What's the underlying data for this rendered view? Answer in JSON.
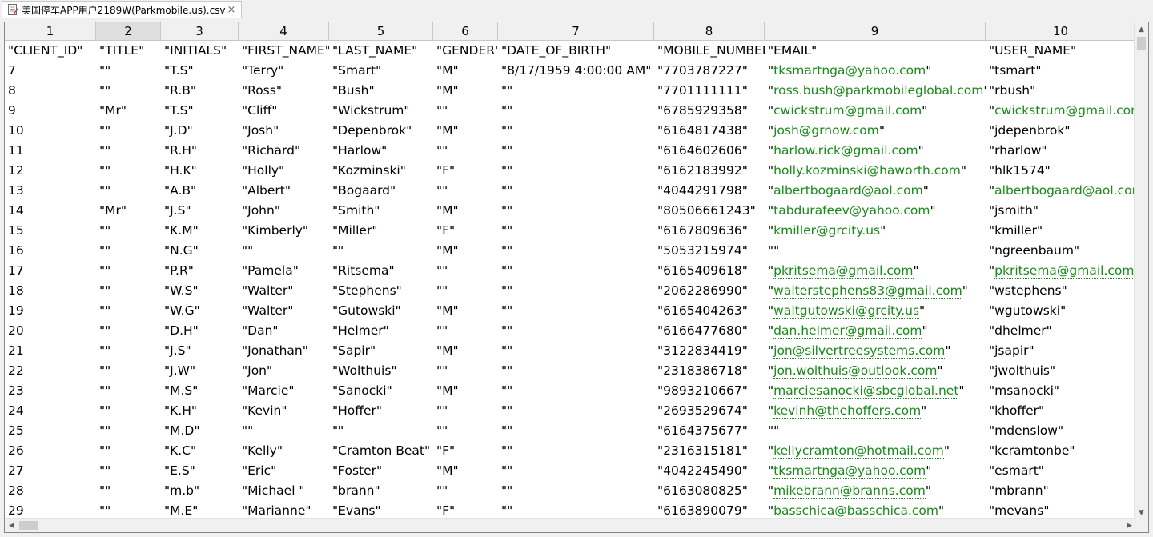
{
  "tab": {
    "title": "美国停车APP用户2189W(Parkmobile.us).csv",
    "close_glyph": "×",
    "icon": "csv-file-icon"
  },
  "column_numbers": [
    "1",
    "2",
    "3",
    "4",
    "5",
    "6",
    "7",
    "8",
    "9",
    "10"
  ],
  "selected_column": "2",
  "rows": [
    [
      "\"CLIENT_ID\"",
      "\"TITLE\"",
      "\"INITIALS\"",
      "\"FIRST_NAME\"",
      "\"LAST_NAME\"",
      "\"GENDER\"",
      "\"DATE_OF_BIRTH\"",
      "\"MOBILE_NUMBER\"",
      "\"EMAIL\"",
      "\"USER_NAME\""
    ],
    [
      "7",
      "\"\"",
      "\"T.S\"",
      "\"Terry\"",
      "\"Smart\"",
      "\"M\"",
      "\"8/17/1959 4:00:00 AM\"",
      "\"7703787227\"",
      "\"tksmartnga@yahoo.com\"",
      "\"tsmart\""
    ],
    [
      "8",
      "\"\"",
      "\"R.B\"",
      "\"Ross\"",
      "\"Bush\"",
      "\"M\"",
      "\"\"",
      "\"7701111111\"",
      "\"ross.bush@parkmobileglobal.com\"",
      "\"rbush\""
    ],
    [
      "9",
      "\"Mr\"",
      "\"T.S\"",
      "\"Cliff\"",
      "\"Wickstrum\"",
      "\"\"",
      "\"\"",
      "\"6785929358\"",
      "\"cwickstrum@gmail.com\"",
      "\"cwickstrum@gmail.com\""
    ],
    [
      "10",
      "\"\"",
      "\"J.D\"",
      "\"Josh\"",
      "\"Depenbrok\"",
      "\"M\"",
      "\"\"",
      "\"6164817438\"",
      "\"josh@grnow.com\"",
      "\"jdepenbrok\""
    ],
    [
      "11",
      "\"\"",
      "\"R.H\"",
      "\"Richard\"",
      "\"Harlow\"",
      "\"\"",
      "\"\"",
      "\"6164602606\"",
      "\"harlow.rick@gmail.com\"",
      "\"rharlow\""
    ],
    [
      "12",
      "\"\"",
      "\"H.K\"",
      "\"Holly\"",
      "\"Kozminski\"",
      "\"F\"",
      "\"\"",
      "\"6162183992\"",
      "\"holly.kozminski@haworth.com\"",
      "\"hlk1574\""
    ],
    [
      "13",
      "\"\"",
      "\"A.B\"",
      "\"Albert\"",
      "\"Bogaard\"",
      "\"\"",
      "\"\"",
      "\"4044291798\"",
      "\"albertbogaard@aol.com\"",
      "\"albertbogaard@aol.com\""
    ],
    [
      "14",
      "\"Mr\"",
      "\"J.S\"",
      "\"John\"",
      "\"Smith\"",
      "\"M\"",
      "\"\"",
      "\"80506661243\"",
      "\"tabdurafeev@yahoo.com\"",
      "\"jsmith\""
    ],
    [
      "15",
      "\"\"",
      "\"K.M\"",
      "\"Kimberly\"",
      "\"Miller\"",
      "\"F\"",
      "\"\"",
      "\"6167809636\"",
      "\"kmiller@grcity.us\"",
      "\"kmiller\""
    ],
    [
      "16",
      "\"\"",
      "\"N.G\"",
      "\"\"",
      "\"\"",
      "\"M\"",
      "\"\"",
      "\"5053215974\"",
      "\"\"",
      "\"ngreenbaum\""
    ],
    [
      "17",
      "\"\"",
      "\"P.R\"",
      "\"Pamela\"",
      "\"Ritsema\"",
      "\"\"",
      "\"\"",
      "\"6165409618\"",
      "\"pkritsema@gmail.com\"",
      "\"pkritsema@gmail.com\""
    ],
    [
      "18",
      "\"\"",
      "\"W.S\"",
      "\"Walter\"",
      "\"Stephens\"",
      "\"\"",
      "\"\"",
      "\"2062286990\"",
      "\"walterstephens83@gmail.com\"",
      "\"wstephens\""
    ],
    [
      "19",
      "\"\"",
      "\"W.G\"",
      "\"Walter\"",
      "\"Gutowski\"",
      "\"M\"",
      "\"\"",
      "\"6165404263\"",
      "\"waltgutowski@grcity.us\"",
      "\"wgutowski\""
    ],
    [
      "20",
      "\"\"",
      "\"D.H\"",
      "\"Dan\"",
      "\"Helmer\"",
      "\"\"",
      "\"\"",
      "\"6166477680\"",
      "\"dan.helmer@gmail.com\"",
      "\"dhelmer\""
    ],
    [
      "21",
      "\"\"",
      "\"J.S\"",
      "\"Jonathan\"",
      "\"Sapir\"",
      "\"M\"",
      "\"\"",
      "\"3122834419\"",
      "\"jon@silvertreesystems.com\"",
      "\"jsapir\""
    ],
    [
      "22",
      "\"\"",
      "\"J.W\"",
      "\"Jon\"",
      "\"Wolthuis\"",
      "\"\"",
      "\"\"",
      "\"2318386718\"",
      "\"jon.wolthuis@outlook.com\"",
      "\"jwolthuis\""
    ],
    [
      "23",
      "\"\"",
      "\"M.S\"",
      "\"Marcie\"",
      "\"Sanocki\"",
      "\"M\"",
      "\"\"",
      "\"9893210667\"",
      "\"marciesanocki@sbcglobal.net\"",
      "\"msanocki\""
    ],
    [
      "24",
      "\"\"",
      "\"K.H\"",
      "\"Kevin\"",
      "\"Hoffer\"",
      "\"\"",
      "\"\"",
      "\"2693529674\"",
      "\"kevinh@thehoffers.com\"",
      "\"khoffer\""
    ],
    [
      "25",
      "\"\"",
      "\"M.D\"",
      "\"\"",
      "\"\"",
      "\"\"",
      "\"\"",
      "\"6164375677\"",
      "\"\"",
      "\"mdenslow\""
    ],
    [
      "26",
      "\"\"",
      "\"K.C\"",
      "\"Kelly\"",
      "\"Cramton Beat\"",
      "\"F\"",
      "\"\"",
      "\"2316315181\"",
      "\"kellycramton@hotmail.com\"",
      "\"kcramtonbe\""
    ],
    [
      "27",
      "\"\"",
      "\"E.S\"",
      "\"Eric\"",
      "\"Foster\"",
      "\"M\"",
      "\"\"",
      "\"4042245490\"",
      "\"tksmartnga@yahoo.com\"",
      "\"esmart\""
    ],
    [
      "28",
      "\"\"",
      "\"m.b\"",
      "\"Michael \"",
      "\"brann\"",
      "\"\"",
      "\"\"",
      "\"6163080825\"",
      "\"mikebrann@branns.com\"",
      "\"mbrann\""
    ],
    [
      "29",
      "\"\"",
      "\"M.E\"",
      "\"Marianne\"",
      "\"Evans\"",
      "\"F\"",
      "\"\"",
      "\"6163890079\"",
      "\"basschica@basschica.com\"",
      "\"mevans\""
    ]
  ],
  "scroll": {
    "up_glyph": "▲",
    "down_glyph": "▼",
    "left_glyph": "◀",
    "right_glyph": "▶"
  },
  "colors": {
    "link": "#1a8a1a",
    "selected_header": "#dedede"
  }
}
